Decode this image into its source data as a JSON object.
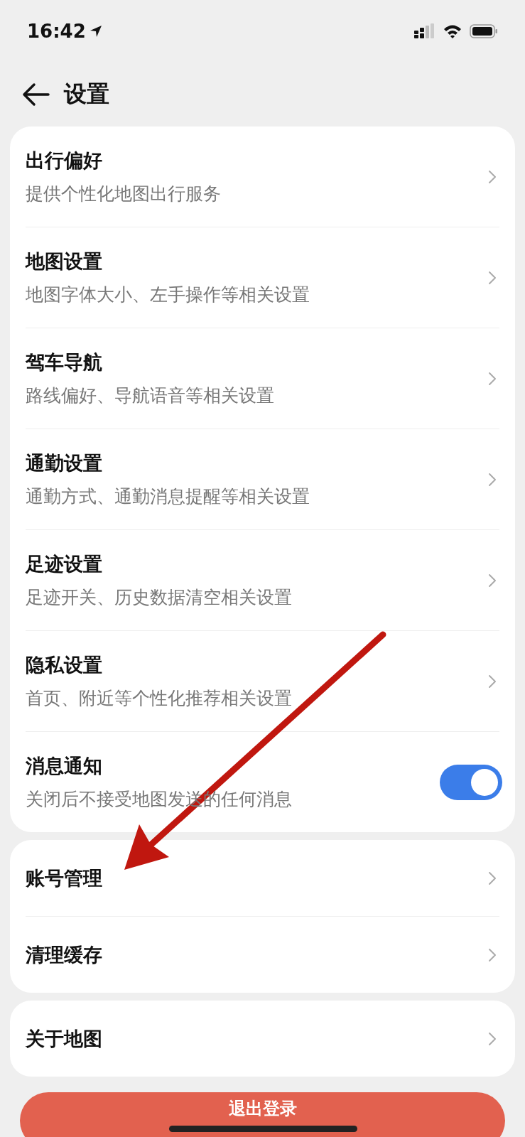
{
  "status_bar": {
    "time": "16:42"
  },
  "header": {
    "title": "设置"
  },
  "groups": [
    {
      "items": [
        {
          "title": "出行偏好",
          "subtitle": "提供个性化地图出行服务",
          "kind": "link"
        },
        {
          "title": "地图设置",
          "subtitle": "地图字体大小、左手操作等相关设置",
          "kind": "link"
        },
        {
          "title": "驾车导航",
          "subtitle": "路线偏好、导航语音等相关设置",
          "kind": "link"
        },
        {
          "title": "通勤设置",
          "subtitle": "通勤方式、通勤消息提醒等相关设置",
          "kind": "link"
        },
        {
          "title": "足迹设置",
          "subtitle": "足迹开关、历史数据清空相关设置",
          "kind": "link"
        },
        {
          "title": "隐私设置",
          "subtitle": "首页、附近等个性化推荐相关设置",
          "kind": "link"
        },
        {
          "title": "消息通知",
          "subtitle": "关闭后不接受地图发送的任何消息",
          "kind": "toggle",
          "on": true
        }
      ]
    },
    {
      "items": [
        {
          "title": "账号管理",
          "kind": "link"
        },
        {
          "title": "清理缓存",
          "kind": "link"
        }
      ]
    },
    {
      "items": [
        {
          "title": "关于地图",
          "kind": "link"
        }
      ]
    }
  ],
  "logout_button": {
    "label": "退出登录"
  }
}
